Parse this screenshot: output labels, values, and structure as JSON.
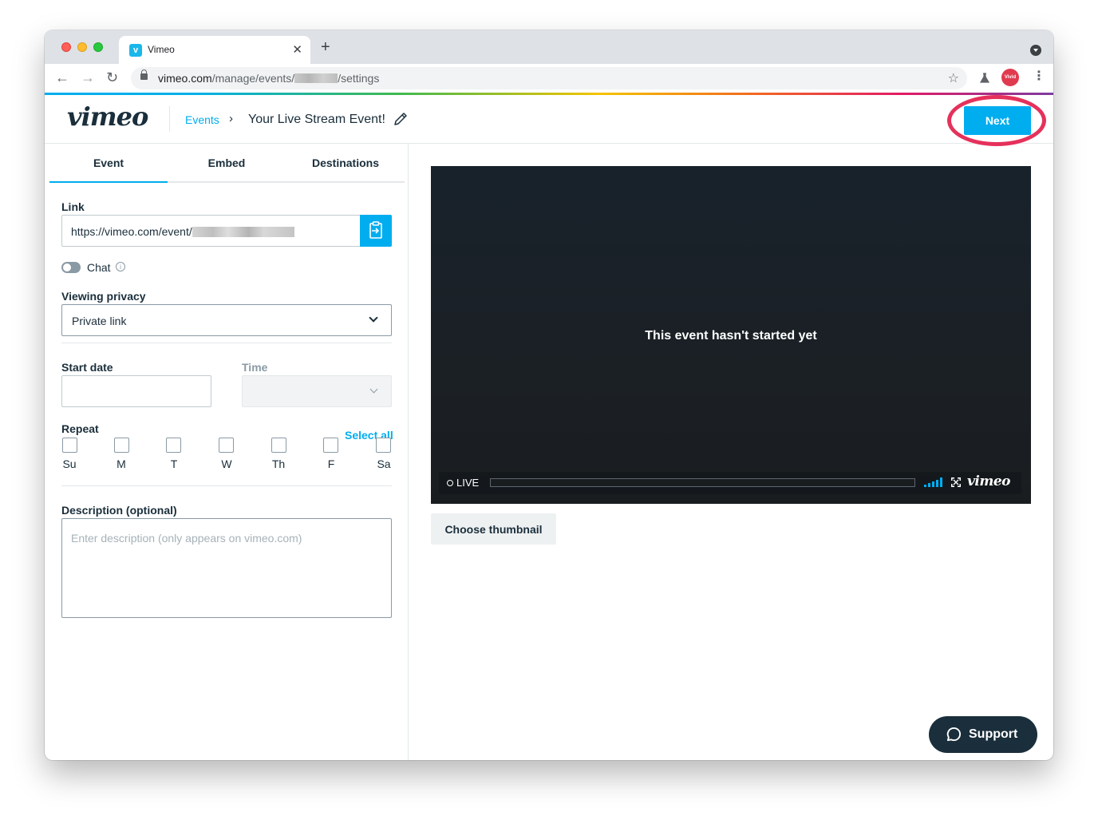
{
  "browser": {
    "tab_title": "Vimeo",
    "tab_favicon": "v",
    "tab_close": "✕",
    "new_tab": "+",
    "url_domain": "vimeo.com",
    "url_path_a": "/manage/events/",
    "url_path_b": "/settings",
    "back": "←",
    "forward": "→",
    "reload": "↻",
    "star": "☆",
    "kebab": "⋮",
    "profile_text": "Vivid SNAPS"
  },
  "header": {
    "logo": "vimeo",
    "breadcrumb_events": "Events",
    "breadcrumb_sep": "›",
    "page_title": "Your Live Stream Event!",
    "next_label": "Next",
    "accent": "#00adef",
    "highlight_color": "#e5315b"
  },
  "tabs": [
    {
      "label": "Event",
      "active": true
    },
    {
      "label": "Embed",
      "active": false
    },
    {
      "label": "Destinations",
      "active": false
    }
  ],
  "form": {
    "link_label": "Link",
    "link_value": "https://vimeo.com/event/",
    "chat_label": "Chat",
    "chat_enabled": false,
    "chat_info": "i",
    "privacy_label": "Viewing privacy",
    "privacy_value": "Private link",
    "start_date_label": "Start date",
    "start_date_value": "",
    "time_label": "Time",
    "time_value": "",
    "repeat_label": "Repeat",
    "select_all": "Select all",
    "days": [
      "Su",
      "M",
      "T",
      "W",
      "Th",
      "F",
      "Sa"
    ],
    "description_label": "Description (optional)",
    "description_placeholder": "Enter description (only appears on vimeo.com)"
  },
  "player": {
    "message": "This event hasn't started yet",
    "live_label": "LIVE",
    "logo": "vimeo"
  },
  "actions": {
    "choose_thumbnail": "Choose thumbnail",
    "support": "Support"
  }
}
